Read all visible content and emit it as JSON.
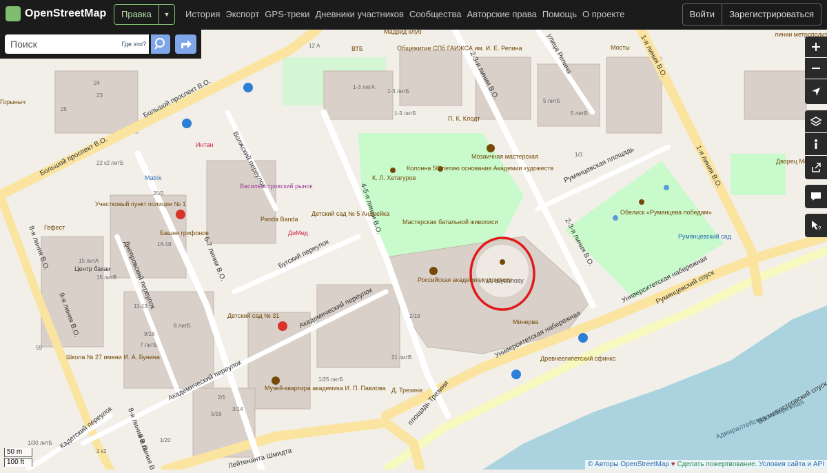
{
  "header": {
    "brand": "OpenStreetMap",
    "edit": "Правка",
    "nav": [
      "История",
      "Экспорт",
      "GPS-треки",
      "Дневники участников",
      "Сообщества",
      "Авторские права",
      "Помощь",
      "О проекте"
    ],
    "login": "Войти",
    "signup": "Зарегистрироваться"
  },
  "search": {
    "placeholder": "Поиск",
    "where": "Где это?"
  },
  "map": {
    "streets": {
      "bolshoy": "Большой проспект В.О.",
      "bolshoy2": "Большой проспект В.О.",
      "volzhsky": "Волжский переулок",
      "bugsky": "Бугский переулок",
      "akadem": "Академический переулок",
      "akadem2": "Академический переулок",
      "dneprov": "Днепровский переулок",
      "kadetsky": "Кадетский переулок",
      "line67": "6-7 линии В.О.",
      "line45": "4-5-я линии В.О.",
      "line23": "2-3-я линии В.О.",
      "line23b": "2-3-я линия В.О.",
      "line89": "8-я линия В.О.",
      "line9": "9-я линия В.О.",
      "line89b": "8-я линия В.О.",
      "line9b": "9-я линия В.О.",
      "line1": "1-я линия В.О.",
      "line1b": "1-я линия В.О.",
      "rumyantsev": "Румянцевская площадь",
      "univ_nab": "Университетская набережная",
      "univ_nab2": "Университетская набережная",
      "rum_spusk": "Румянцевский спуск",
      "trezini": "площадь Трезини",
      "schmidt": "Лейтенанта Шмидта",
      "vas_spusk": "Василеостровский спуск",
      "admir": "Адмиралтейская набережная",
      "repina": "улица Репина"
    },
    "labels": {
      "club": "Мадрид клуб",
      "vtb": "ВТБ",
      "obshezhitie": "Общежитие СПб ГАИЖСА им. И. Е. Репина",
      "klodt": "П. К. Клодт",
      "mozaic": "Мозаичная мастерская",
      "hetagurov": "К. Л. Хетагуров",
      "kolonna": "Колонна 50-летию основания Академии художеств",
      "batal": "Мастерская батальной живописи",
      "shuvalov": "И. И. Шувалову",
      "ros_akad": "Российская академия художеств",
      "minerva": "Минерва",
      "sfinks": "Древнеегипетский сфинкс",
      "obelisk": "Обелиск «Румянцева победам»",
      "rum_sad": "Румянцевский сад",
      "mosty": "Мосты",
      "dvorets": "Дворец Меншикова",
      "metro": "линии метрополитена",
      "intan": "Интан",
      "vas_market": "Василеостровский рынок",
      "panda": "Panda Banda",
      "dimed": "ДиМед",
      "detsad5": "Детский сад № 5 Андрейка",
      "bashnya": "Башня грифонов",
      "uch_punkt": "Участковый пункт полиции № 1",
      "matrix": "Matrix",
      "gefest": "Гефест",
      "bahai": "Центр бахаи",
      "detsad31": "Детский сад № 31",
      "school": "Школа № 27 имени И. А. Бунина",
      "pavlov": "Музей-квартира академика И. П. Павлова",
      "gorynych": "Горыныч",
      "d_trezini": "Д. Трезини",
      "h15": "15 литА",
      "h15b": "15 литВ",
      "h11": "11-13",
      "h916": "9/16",
      "h8": "8 литБ",
      "h7": "7 литБ",
      "h219": "2/19",
      "h21": "21 литВ",
      "h1725": "1/25 литБ",
      "h21b": "2/1",
      "h314": "3/14",
      "h516": "5/16",
      "h22": "22 к2 литБ",
      "h202": "20/2",
      "h1618": "16-18",
      "h24": "24",
      "h25": "25",
      "h23": "23",
      "h59": "59",
      "h130": "1/30 литБ",
      "h120": "1/20",
      "h2k2": "2 к2",
      "h1_3": "1-3 литА",
      "h1_3b": "1-3 литБ",
      "h1_3c": "1-3 литБ",
      "h5": "5 литБ",
      "h5b": "5 литВ",
      "h13": "1/3",
      "h12a": "12 А"
    }
  },
  "scale": {
    "metric": "50 m",
    "imperial": "100 ft"
  },
  "attribution": {
    "authors": "© Авторы OpenStreetMap",
    "heart": "♥",
    "donate": "Сделать пожертвование",
    "terms": ". Условия сайта и API"
  },
  "colors": {
    "header": "#1b1b1b",
    "accent": "#7ebc6f",
    "water": "#aad3df",
    "park": "#c8facc",
    "annotation": "#e01a1a"
  }
}
